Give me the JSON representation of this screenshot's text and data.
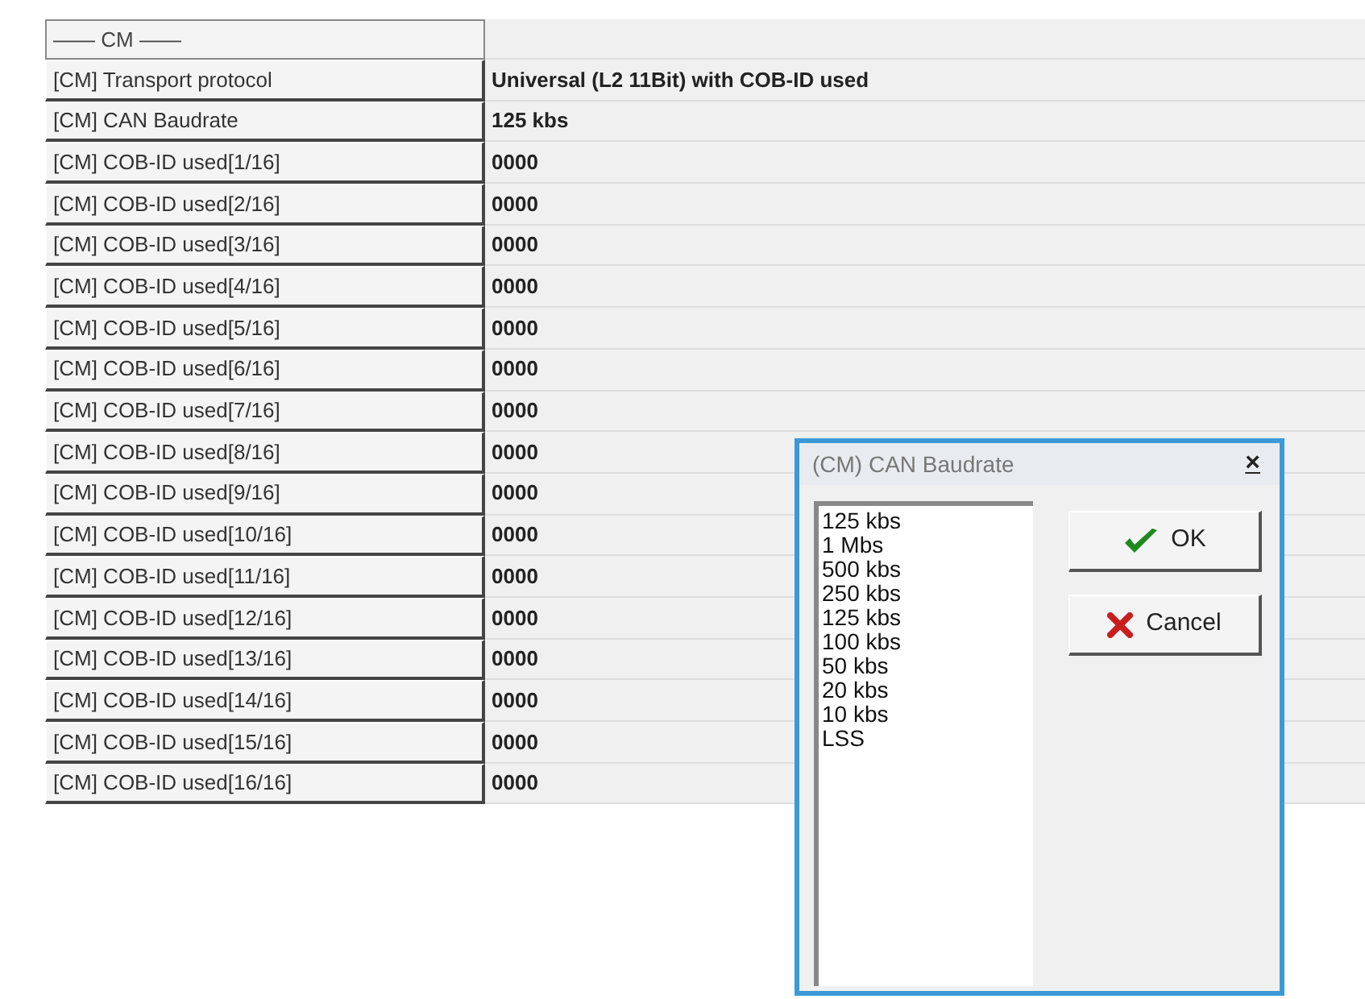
{
  "table": {
    "section": "—— CM ——",
    "rows": [
      {
        "name": "[CM] Transport protocol",
        "value": "Universal (L2 11Bit) with COB-ID used"
      },
      {
        "name": "[CM] CAN Baudrate",
        "value": "125 kbs"
      },
      {
        "name": "[CM] COB-ID used[1/16]",
        "value": "0000"
      },
      {
        "name": "[CM] COB-ID used[2/16]",
        "value": "0000"
      },
      {
        "name": "[CM] COB-ID used[3/16]",
        "value": "0000"
      },
      {
        "name": "[CM] COB-ID used[4/16]",
        "value": "0000"
      },
      {
        "name": "[CM] COB-ID used[5/16]",
        "value": "0000"
      },
      {
        "name": "[CM] COB-ID used[6/16]",
        "value": "0000"
      },
      {
        "name": "[CM] COB-ID used[7/16]",
        "value": "0000"
      },
      {
        "name": "[CM] COB-ID used[8/16]",
        "value": "0000"
      },
      {
        "name": "[CM] COB-ID used[9/16]",
        "value": "0000"
      },
      {
        "name": "[CM] COB-ID used[10/16]",
        "value": "0000"
      },
      {
        "name": "[CM] COB-ID used[11/16]",
        "value": "0000"
      },
      {
        "name": "[CM] COB-ID used[12/16]",
        "value": "0000"
      },
      {
        "name": "[CM] COB-ID used[13/16]",
        "value": "0000"
      },
      {
        "name": "[CM] COB-ID used[14/16]",
        "value": "0000"
      },
      {
        "name": "[CM] COB-ID used[15/16]",
        "value": "0000"
      },
      {
        "name": "[CM] COB-ID used[16/16]",
        "value": "0000"
      }
    ]
  },
  "dialog": {
    "title": "(CM) CAN Baudrate",
    "close": "×",
    "options": [
      "125 kbs",
      "1 Mbs",
      "500 kbs",
      "250 kbs",
      "125 kbs",
      "100 kbs",
      "50 kbs",
      "20 kbs",
      "10 kbs",
      "LSS"
    ],
    "buttons": [
      {
        "kind": "ok",
        "label": "OK"
      },
      {
        "kind": "cancel",
        "label": "Cancel"
      }
    ]
  }
}
